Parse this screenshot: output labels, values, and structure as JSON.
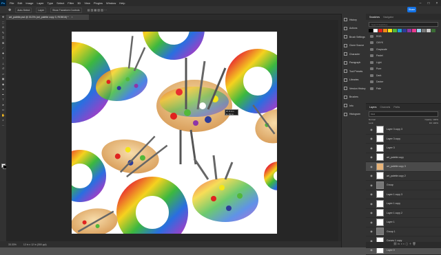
{
  "app": {
    "logo": "Ps",
    "menu": [
      "File",
      "Edit",
      "Image",
      "Layer",
      "Type",
      "Select",
      "Filter",
      "3D",
      "View",
      "Plugins",
      "Window",
      "Help"
    ]
  },
  "options": {
    "auto_select": "Auto-Select",
    "layer": "Layer",
    "show_transform": "Show Transform Controls",
    "share": "Share"
  },
  "document": {
    "tab_title": "art_palette.psd @ 33.3% (art_palette copy 3, RGB/16) *",
    "tooltip_line1": "W: 8.0 in",
    "tooltip_line2": "H: 8.0 in"
  },
  "status": {
    "zoom": "33.33%",
    "info": "12 in x 12 in (300 ppi)"
  },
  "collapsed_panels": [
    "History",
    "Actions",
    "Brush Settings",
    "Clone Source",
    "Character",
    "Paragraph",
    "Tool Presets",
    "Libraries",
    "Version History",
    "Brushes",
    "Info",
    "Histogram"
  ],
  "swatches": {
    "tabs": [
      "Swatches",
      "Navigator"
    ],
    "search_placeholder": "Search Swatches",
    "colors": [
      "#000000",
      "#ffffff",
      "#e0221f",
      "#f08a16",
      "#f5e617",
      "#52b83a",
      "#1ba2d8",
      "#2d3c99",
      "#8e35a8",
      "#e83b8d",
      "#9fd3ef",
      "#7a7a7a",
      "#c8c8c8",
      "#3b6c35"
    ],
    "folders": [
      "RGB",
      "CMYK",
      "Grayscale",
      "Pastel",
      "Light",
      "Pure",
      "Dark",
      "Darker",
      "Pale"
    ]
  },
  "layers": {
    "tabs": [
      "Layers",
      "Channels",
      "Paths"
    ],
    "filter": "Kind",
    "blend_mode": "Normal",
    "opacity": "Opacity: 100%",
    "lock": "Lock:",
    "fill": "Fill: 100%",
    "items": [
      {
        "name": "Layer 3 copy 3",
        "selected": false
      },
      {
        "name": "Layer 3 copy",
        "selected": false
      },
      {
        "name": "Layer 3",
        "selected": false
      },
      {
        "name": "art_palette copy",
        "selected": false
      },
      {
        "name": "art_palette copy 3",
        "selected": true
      },
      {
        "name": "art_palette copy 2",
        "selected": false
      },
      {
        "name": "Group",
        "selected": false
      },
      {
        "name": "Layer 1 copy 3",
        "selected": false
      },
      {
        "name": "Layer 1 copy",
        "selected": false
      },
      {
        "name": "Layer 1 copy 2",
        "selected": false
      },
      {
        "name": "Layer 1",
        "selected": false
      },
      {
        "name": "Group 1",
        "selected": false
      },
      {
        "name": "Curves 1 copy",
        "selected": false
      },
      {
        "name": "Layer 0",
        "selected": false
      }
    ]
  }
}
